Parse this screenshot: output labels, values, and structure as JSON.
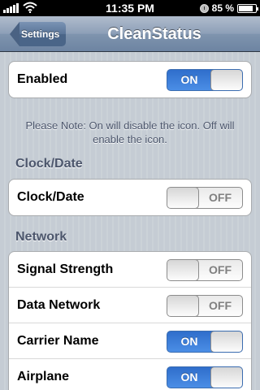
{
  "status_bar": {
    "time": "11:35 PM",
    "battery": "85 %",
    "battery_fraction": 0.85,
    "signal_icon": "signal-bars-icon",
    "wifi_icon": "wifi-icon",
    "lock_icon": "orientation-lock-icon"
  },
  "nav": {
    "back_label": "Settings",
    "title": "CleanStatus"
  },
  "enabled_row": {
    "label": "Enabled",
    "state": "ON"
  },
  "note": "Please Note: On will disable the icon. Off will enable the icon.",
  "sections": {
    "clock": {
      "header": "Clock/Date",
      "rows": [
        {
          "label": "Clock/Date",
          "state": "OFF"
        }
      ]
    },
    "network": {
      "header": "Network",
      "rows": [
        {
          "label": "Signal Strength",
          "state": "OFF"
        },
        {
          "label": "Data Network",
          "state": "OFF"
        },
        {
          "label": "Carrier Name",
          "state": "ON"
        },
        {
          "label": "Airplane",
          "state": "ON"
        }
      ]
    }
  },
  "colors": {
    "switch_on": "#3b7fdb",
    "background": "#c5ccd4",
    "nav_bar": "#7f94ae"
  }
}
